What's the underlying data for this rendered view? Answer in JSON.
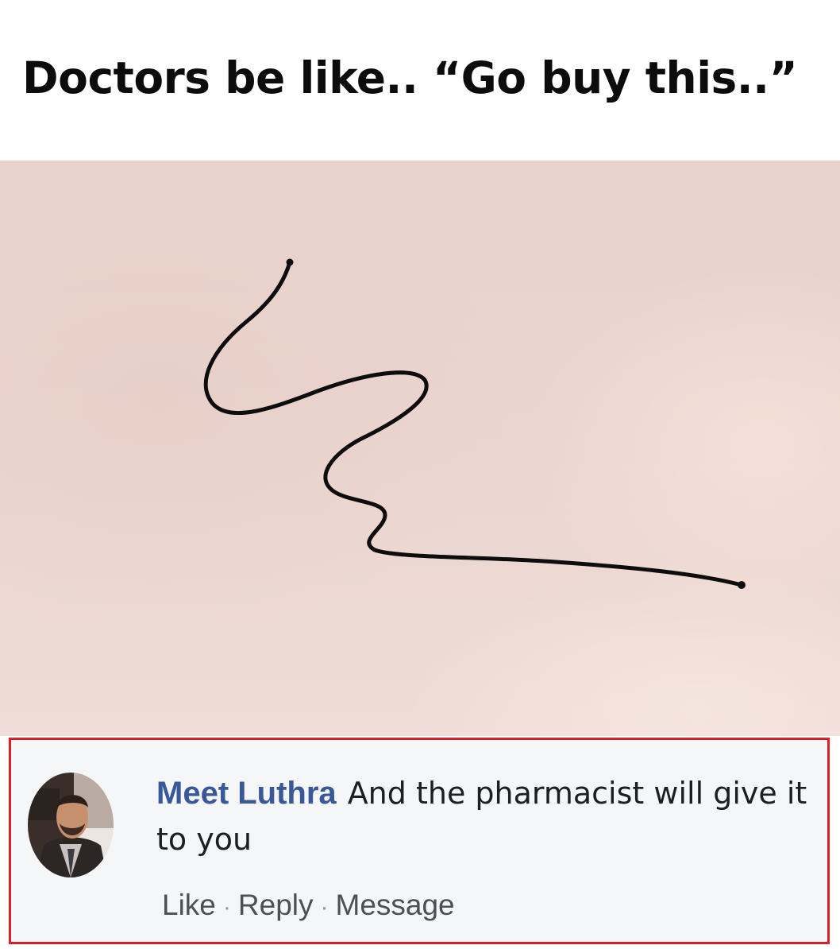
{
  "caption": {
    "text": "Doctors be like.. “Go buy this..”"
  },
  "comment": {
    "author": "Meet Luthra",
    "text": "And the pharmacist will give it to you",
    "actions": {
      "like": "Like",
      "reply": "Reply",
      "message": "Message",
      "separator": "·"
    },
    "frame_color": "#d8202a",
    "author_color": "#385898"
  }
}
